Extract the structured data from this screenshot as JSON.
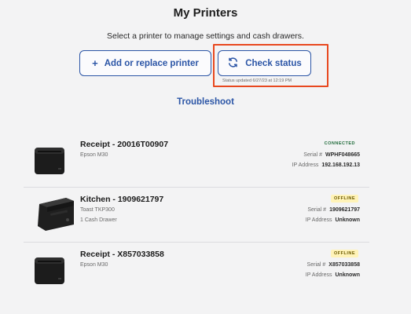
{
  "page": {
    "title": "My Printers",
    "subtitle": "Select a printer to manage settings and cash drawers.",
    "add_label": "Add or replace printer",
    "add_icon": "plus-icon",
    "check_label": "Check status",
    "check_icon": "refresh-icon",
    "status_updated": "Status updated 6/27/23 at 12:19 PM",
    "troubleshoot_label": "Troubleshoot",
    "accent_color": "#2b55a6",
    "highlight_color": "#e8481f"
  },
  "printers": [
    {
      "name": "Receipt - 20016T00907",
      "model": "Epson M30",
      "drawer": "",
      "status": "CONNECTED",
      "serial_label": "Serial #",
      "serial": "WPHF048665",
      "ip_label": "IP Address",
      "ip": "192.168.192.13",
      "icon": "receipt-printer-icon"
    },
    {
      "name": "Kitchen - 1909621797",
      "model": "Toast TKP300",
      "drawer": "1 Cash Drawer",
      "status": "OFFLINE",
      "serial_label": "Serial #",
      "serial": "1909621797",
      "ip_label": "IP Address",
      "ip": "Unknown",
      "icon": "kitchen-printer-icon"
    },
    {
      "name": "Receipt - X857033858",
      "model": "Epson M30",
      "drawer": "",
      "status": "OFFLINE",
      "serial_label": "Serial #",
      "serial": "X857033858",
      "ip_label": "IP Address",
      "ip": "Unknown",
      "icon": "receipt-printer-icon"
    }
  ]
}
